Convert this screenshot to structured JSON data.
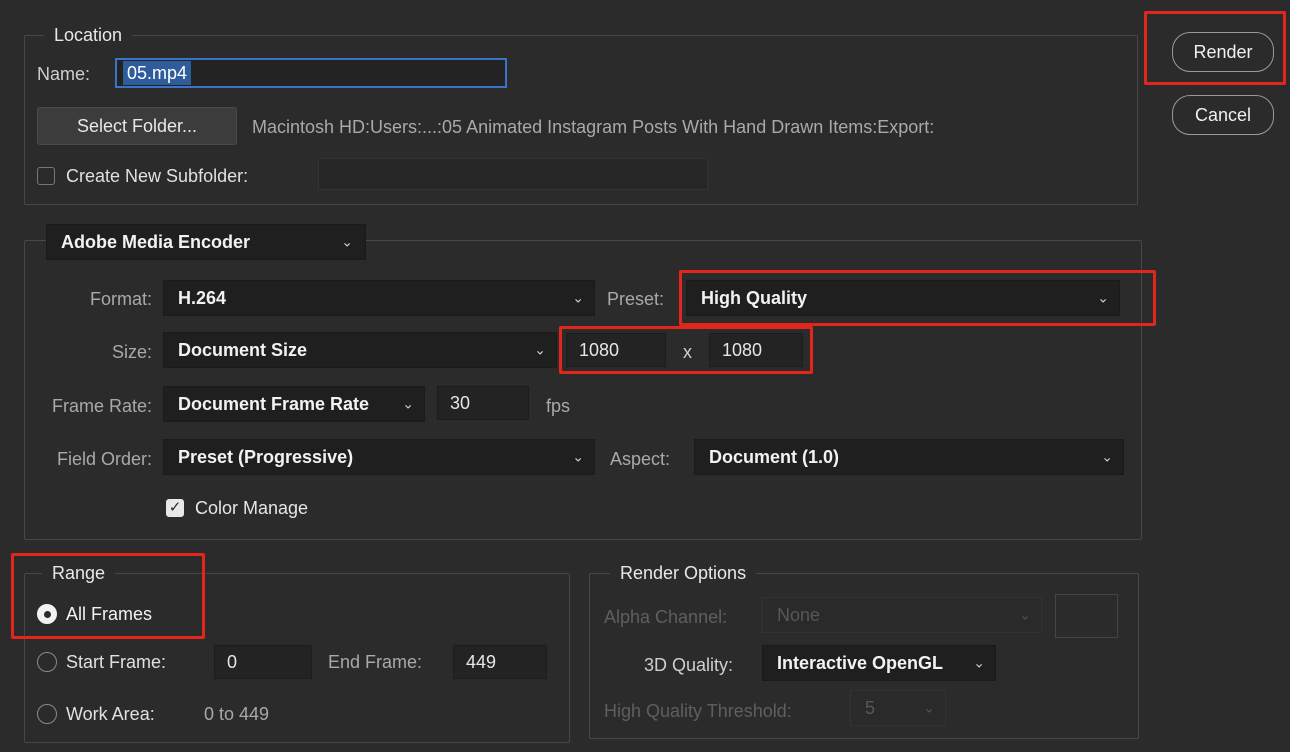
{
  "location": {
    "legend": "Location",
    "name_label": "Name:",
    "name_value": "05.mp4",
    "select_folder": "Select Folder...",
    "path": "Macintosh HD:Users:...:05 Animated Instagram Posts With Hand Drawn Items:Export:",
    "create_subfolder_label": "Create New Subfolder:",
    "create_subfolder_checked": false,
    "subfolder_value": ""
  },
  "buttons": {
    "render": "Render",
    "cancel": "Cancel"
  },
  "encoder": {
    "selector": "Adobe Media Encoder",
    "format_label": "Format:",
    "format_value": "H.264",
    "preset_label": "Preset:",
    "preset_value": "High Quality",
    "size_label": "Size:",
    "size_value": "Document Size",
    "width": "1080",
    "x": "x",
    "height": "1080",
    "frame_rate_label": "Frame Rate:",
    "frame_rate_value": "Document Frame Rate",
    "fps_value": "30",
    "fps_label": "fps",
    "field_order_label": "Field Order:",
    "field_order_value": "Preset (Progressive)",
    "aspect_label": "Aspect:",
    "aspect_value": "Document (1.0)",
    "color_manage_label": "Color Manage",
    "color_manage_checked": true
  },
  "range": {
    "legend": "Range",
    "all_frames": "All Frames",
    "start_frame_label": "Start Frame:",
    "start_frame_value": "0",
    "end_frame_label": "End Frame:",
    "end_frame_value": "449",
    "work_area_label": "Work Area:",
    "work_area_value": "0 to 449",
    "selected": "all_frames"
  },
  "render_options": {
    "legend": "Render Options",
    "alpha_label": "Alpha Channel:",
    "alpha_value": "None",
    "quality_label": "3D Quality:",
    "quality_value": "Interactive OpenGL",
    "threshold_label": "High Quality Threshold:",
    "threshold_value": "5"
  },
  "icons": {
    "dropdown": "chevron-down-icon",
    "check": "checkmark-icon"
  },
  "colors": {
    "highlight": "#e3261c",
    "background": "#2b2b2b"
  }
}
